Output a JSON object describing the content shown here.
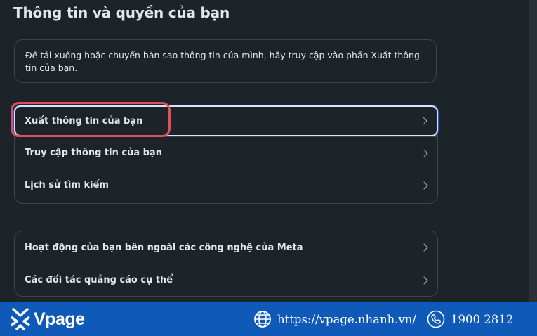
{
  "page": {
    "title": "Thông tin và quyền của bạn"
  },
  "info": {
    "text": "Để tải xuống hoặc chuyển bản sao thông tin của mình, hãy truy cập vào phần Xuất thông tin của bạn."
  },
  "menu_group_1": [
    {
      "label": "Xuất thông tin của bạn"
    },
    {
      "label": "Truy cập thông tin của bạn"
    },
    {
      "label": "Lịch sử tìm kiếm"
    }
  ],
  "menu_group_2": [
    {
      "label": "Hoạt động của bạn bên ngoài các công nghệ của Meta"
    },
    {
      "label": "Các đối tác quảng cáo cụ thể"
    }
  ],
  "footer": {
    "brand": "Vpage",
    "website": "https://vpage.nhanh.vn/",
    "phone": "1900 2812"
  },
  "colors": {
    "background": "#1c2329",
    "border": "#3e4449",
    "highlight": "#e0505a",
    "footer": "#0f5ab8"
  },
  "icons": [
    "chevron-right-icon",
    "vpage-logo-icon",
    "globe-icon",
    "phone-icon"
  ]
}
